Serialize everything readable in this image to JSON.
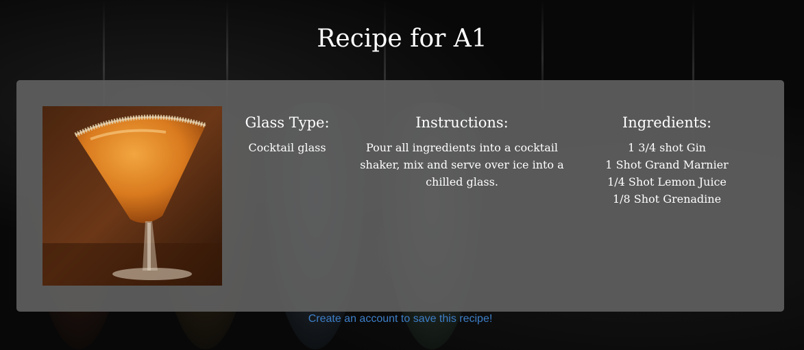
{
  "page": {
    "title": "Recipe for A1"
  },
  "recipe": {
    "image_alt": "A1 cocktail in a sugar-rimmed cocktail glass",
    "glass": {
      "heading": "Glass Type:",
      "value": "Cocktail glass"
    },
    "instructions": {
      "heading": "Instructions:",
      "text": "Pour all ingredients into a cocktail shaker, mix and serve over ice into a chilled glass."
    },
    "ingredients": {
      "heading": "Ingredients:",
      "items": [
        "1 3/4 shot Gin",
        "1 Shot Grand Marnier",
        "1/4 Shot Lemon Juice",
        "1/8 Shot Grenadine"
      ]
    }
  },
  "footer": {
    "signup_link": "Create an account to save this recipe!"
  },
  "colors": {
    "link": "#3d7fc9",
    "card": "#5f5f5f",
    "background": "#0a0a0a"
  }
}
